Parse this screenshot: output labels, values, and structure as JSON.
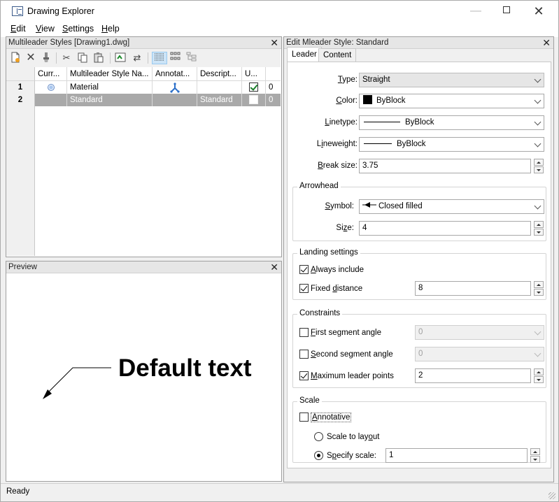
{
  "window": {
    "title": "Drawing Explorer",
    "min": "—",
    "close": "✕"
  },
  "menu": [
    {
      "label": "Edit",
      "key": "E",
      "rest": "dit"
    },
    {
      "label": "View",
      "key": "V",
      "rest": "iew"
    },
    {
      "label": "Settings",
      "key": "S",
      "rest": "ettings"
    },
    {
      "label": "Help",
      "key": "H",
      "rest": "elp"
    }
  ],
  "styles_panel": {
    "title": "Multileader Styles [Drawing1.dwg]",
    "close": "✕",
    "columns": [
      "Curr...",
      "Multileader Style Na...",
      "Annotat...",
      "Descript...",
      "U..."
    ],
    "rows": [
      {
        "num": "1",
        "name": "Material",
        "description": "",
        "used_value": "0",
        "current": true,
        "annotative": true,
        "used_checked": true
      },
      {
        "num": "2",
        "name": "Standard",
        "description": "Standard",
        "used_value": "0",
        "current": false,
        "annotative": false,
        "used_checked": false
      }
    ]
  },
  "preview_panel": {
    "title": "Preview",
    "close": "✕",
    "sample_text": "Default text"
  },
  "edit_panel": {
    "title": "Edit Mleader Style: Standard",
    "close": "✕",
    "tabs": [
      "Leader",
      "Content"
    ],
    "type": {
      "label_pre": "",
      "key": "T",
      "label_post": "ype:",
      "value": "Straight"
    },
    "color": {
      "label_pre": "",
      "key": "C",
      "label_post": "olor:",
      "value": "ByBlock",
      "swatch": "#000000"
    },
    "linetype": {
      "label_pre": "",
      "key": "L",
      "label_post": "inetype:",
      "value": "ByBlock"
    },
    "lineweight": {
      "label_pre": "L",
      "key": "i",
      "label_post": "neweight:",
      "value": "ByBlock"
    },
    "break_size": {
      "label_pre": "",
      "key": "B",
      "label_post": "reak size:",
      "value": "3.75"
    },
    "arrowhead": {
      "title": "Arrowhead",
      "symbol": {
        "label_pre": "",
        "key": "S",
        "label_post": "ymbol:",
        "value": "Closed filled"
      },
      "size": {
        "label_pre": "Si",
        "key": "z",
        "label_post": "e:",
        "value": "4"
      }
    },
    "landing": {
      "title": "Landing settings",
      "always_include": {
        "label_pre": "",
        "key": "A",
        "label_post": "lways include",
        "checked": true
      },
      "fixed_distance": {
        "label_pre": "Fixed ",
        "key": "d",
        "label_post": "istance",
        "checked": true,
        "value": "8"
      }
    },
    "constraints": {
      "title": "Constraints",
      "first_segment": {
        "label_pre": "",
        "key": "F",
        "label_post": "irst segment angle",
        "checked": false,
        "value": "0"
      },
      "second_segment": {
        "label_pre": "",
        "key": "S",
        "label_post": "econd segment angle",
        "checked": false,
        "value": "0"
      },
      "max_points": {
        "label_pre": "",
        "key": "M",
        "label_post": "aximum leader points",
        "checked": true,
        "value": "2"
      }
    },
    "scale": {
      "title": "Scale",
      "annotative": {
        "label_pre": "",
        "key": "A",
        "label_post": "nnotative",
        "checked": false
      },
      "scale_to_layout": {
        "label_pre": "Scale to lay",
        "key": "o",
        "label_post": "ut",
        "selected": false
      },
      "specify_scale": {
        "label_pre": "S",
        "key": "p",
        "label_post": "ecify scale:",
        "selected": true,
        "value": "1"
      }
    }
  },
  "status": {
    "text": "Ready"
  }
}
